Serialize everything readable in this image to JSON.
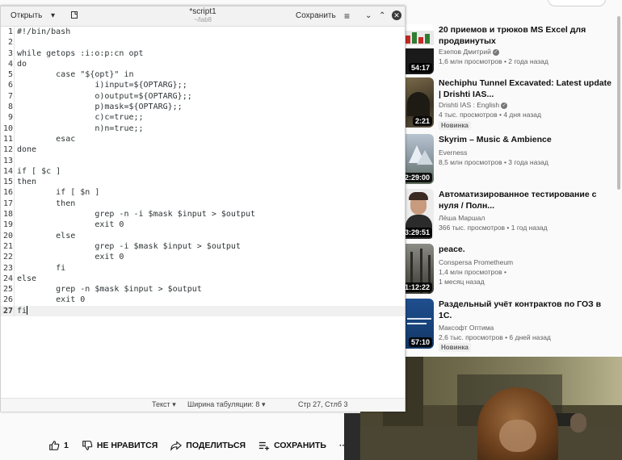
{
  "editor": {
    "open_label": "Открыть",
    "title": "*script1",
    "subtitle": "~/lab8",
    "save_label": "Сохранить",
    "lines": [
      "#!/bin/bash",
      "",
      "while getops :i:o:p:cn opt",
      "do",
      "        case \"${opt}\" in",
      "                i)input=${OPTARG};;",
      "                o)output=${OPTARG};;",
      "                p)mask=${OPTARG};;",
      "                c)c=true;;",
      "                n)n=true;;",
      "        esac",
      "done",
      "",
      "if [ $c ]",
      "then",
      "        if [ $n ]",
      "        then",
      "                grep -n -i $mask $input > $output",
      "                exit 0",
      "        else",
      "                grep -i $mask $input > $output",
      "                exit 0",
      "        fi",
      "else",
      "        grep -n $mask $input > $output",
      "        exit 0",
      "fi"
    ],
    "current_line": 27,
    "status": {
      "language": "Текст",
      "tab_width": "Ширина табуляции: 8",
      "position": "Стр 27, Стлб 3"
    }
  },
  "recommendations": [
    {
      "title": "20 приемов и трюков MS Excel для продвинутых",
      "channel": "Езепов Дмитрий",
      "verified": true,
      "meta": "1,6 млн просмотров • 2 года назад",
      "duration": "54:17",
      "badge": "",
      "thumb": "excel"
    },
    {
      "title": "Nechiphu Tunnel Excavated: Latest update | Drishti IAS...",
      "channel": "Drishti IAS : English",
      "verified": true,
      "meta": "4 тыс. просмотров • 4 дня назад",
      "duration": "2:21",
      "badge": "Новинка",
      "thumb": "tunnel"
    },
    {
      "title": "Skyrim – Music & Ambience",
      "channel": "Everness",
      "verified": false,
      "meta": "8,5 млн просмотров • 3 года назад",
      "duration": "2:29:00",
      "badge": "",
      "thumb": "skyrim"
    },
    {
      "title": "Автоматизированное тестирование с нуля / Полн...",
      "channel": "Лёша Маршал",
      "verified": false,
      "meta": "366 тыс. просмотров • 1 год назад",
      "duration": "3:29:51",
      "badge": "",
      "thumb": "person"
    },
    {
      "title": "peace.",
      "channel": "Conspersa Prometheum",
      "verified": false,
      "meta": "1,4 млн просмотров •",
      "meta2": "1 месяц назад",
      "duration": "1:12:22",
      "badge": "",
      "thumb": "forest"
    },
    {
      "title": "Раздельный учёт контрактов по ГОЗ в 1С.",
      "channel": "Максофт Оптима",
      "verified": false,
      "meta": "2,6 тыс. просмотров • 6 дней назад",
      "duration": "57:10",
      "badge": "Новинка",
      "thumb": "blue"
    }
  ],
  "actions": {
    "like_count": "1",
    "dislike": "НЕ НРАВИТСЯ",
    "share": "ПОДЕЛИТЬСЯ",
    "save": "СОХРАНИТЬ",
    "more": "···"
  }
}
